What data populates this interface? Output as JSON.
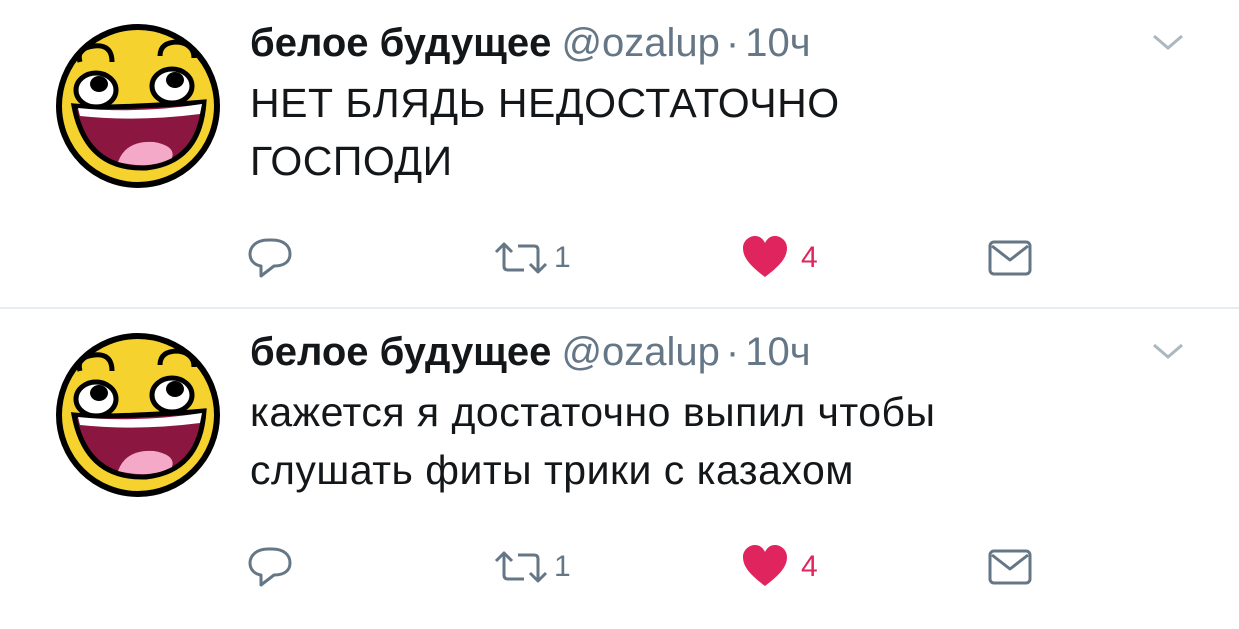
{
  "tweets": [
    {
      "display_name": "белое будущее",
      "handle": "@ozalup",
      "separator": "·",
      "time": "10ч",
      "lines": [
        "НЕТ БЛЯДЬ НЕДОСТАТОЧНО",
        "ГОСПОДИ"
      ],
      "retweet_count": "1",
      "like_count": "4"
    },
    {
      "display_name": "белое будущее",
      "handle": "@ozalup",
      "separator": "·",
      "time": "10ч",
      "lines": [
        "кажется я достаточно выпил чтобы",
        "слушать фиты трики с казахом"
      ],
      "retweet_count": "1",
      "like_count": "4"
    }
  ],
  "icons": {
    "reply": "reply-icon",
    "retweet": "retweet-icon",
    "like": "heart-icon",
    "dm": "envelope-icon",
    "caret": "chevron-down-icon"
  },
  "colors": {
    "text": "#14171a",
    "secondary": "#657786",
    "like": "#e0245e",
    "divider": "#e6ecf0",
    "avatar_face": "#f5d22e"
  }
}
